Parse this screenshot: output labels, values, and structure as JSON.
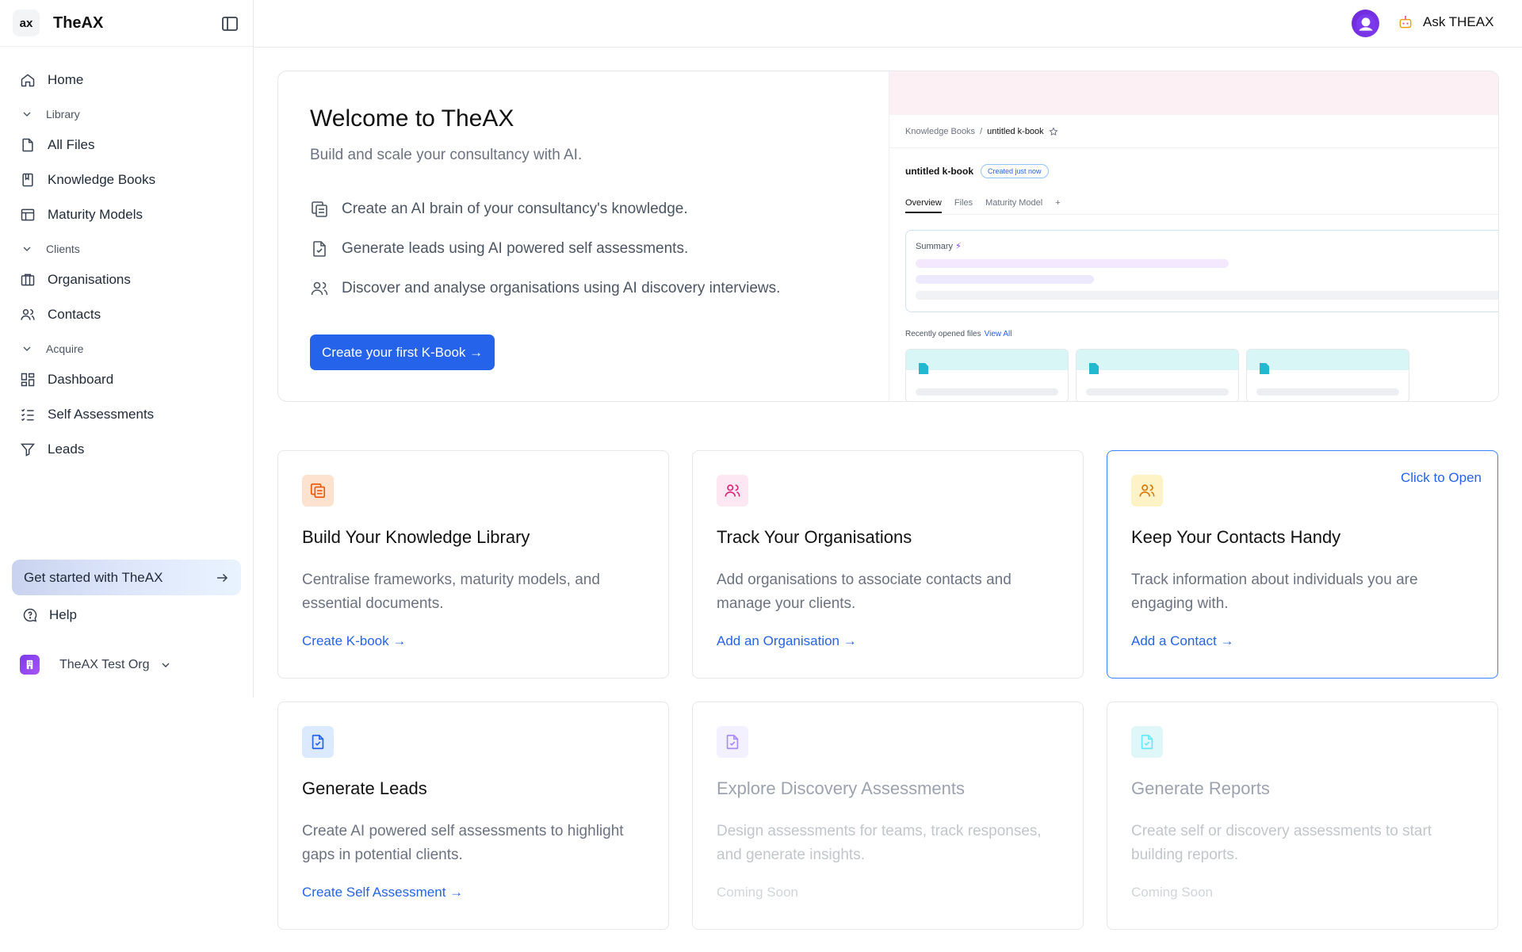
{
  "brand": {
    "logo_text": "ax",
    "name": "TheAX"
  },
  "sidebar": {
    "home": "Home",
    "sections": {
      "library": "Library",
      "clients": "Clients",
      "acquire": "Acquire"
    },
    "library_items": [
      "All Files",
      "Knowledge Books",
      "Maturity Models"
    ],
    "client_items": [
      "Organisations",
      "Contacts"
    ],
    "acquire_items": [
      "Dashboard",
      "Self Assessments",
      "Leads"
    ],
    "get_started": "Get started with TheAX",
    "help": "Help",
    "org_name": "TheAX Test Org"
  },
  "topbar": {
    "ask": "Ask THEAX"
  },
  "welcome": {
    "title": "Welcome to TheAX",
    "subtitle": "Build and scale your consultancy with AI.",
    "features": [
      "Create an AI brain of your consultancy's knowledge.",
      "Generate leads using AI powered self assessments.",
      "Discover and analyse organisations using AI discovery interviews."
    ],
    "cta": "Create your first K-Book →"
  },
  "preview": {
    "breadcrumb_root": "Knowledge Books",
    "breadcrumb_current": "untitled k-book",
    "title": "untitled k-book",
    "pill": "Created just now",
    "tabs": [
      "Overview",
      "Files",
      "Maturity Model"
    ],
    "summary_label": "Summary",
    "recent_label": "Recently opened files",
    "view_all": "View All"
  },
  "cards": [
    {
      "title": "Build Your Knowledge Library",
      "desc": "Centralise frameworks, maturity models, and essential documents.",
      "link": "Create K-book →"
    },
    {
      "title": "Track Your Organisations",
      "desc": "Add organisations to associate contacts and manage your clients.",
      "link": "Add an Organisation →"
    },
    {
      "title": "Keep Your Contacts Handy",
      "desc": "Track information about individuals you are engaging with.",
      "link": "Add a Contact →",
      "open": "Click to Open"
    },
    {
      "title": "Generate Leads",
      "desc": "Create AI powered self assessments to highlight gaps in potential clients.",
      "link": "Create Self Assessment →"
    },
    {
      "title": "Explore Discovery Assessments",
      "desc": "Design assessments for teams, track responses, and generate insights.",
      "link": "Coming Soon"
    },
    {
      "title": "Generate Reports",
      "desc": "Create self or discovery assessments to start building reports.",
      "link": "Coming Soon"
    }
  ],
  "colors": {
    "accent": "#2563eb",
    "avatar": "#7c3aed"
  }
}
